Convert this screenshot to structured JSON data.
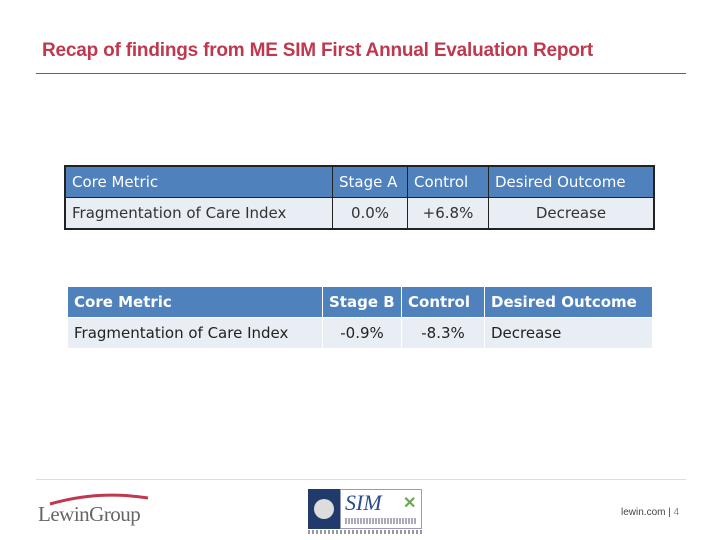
{
  "title": "Recap of findings from ME SIM First Annual Evaluation Report",
  "table_stage_a": {
    "headers": [
      "Core Metric",
      "Stage A",
      "Control",
      "Desired Outcome"
    ],
    "rows": [
      [
        "Fragmentation of Care Index",
        "0.0%",
        "+6.8%",
        "Decrease"
      ]
    ]
  },
  "table_stage_b": {
    "headers": [
      "Core Metric",
      "Stage B",
      "Control",
      "Desired Outcome"
    ],
    "rows": [
      [
        "Fragmentation of Care Index",
        "-0.9%",
        "-8.3%",
        "Decrease"
      ]
    ]
  },
  "footer": {
    "logo_left": "LewinGroup",
    "logo_center": "SIM",
    "site": "lewin.com |",
    "page": "4"
  },
  "colors": {
    "title": "#c0384e",
    "header_fill": "#4f81bd",
    "row_fill": "#e9edf4"
  }
}
